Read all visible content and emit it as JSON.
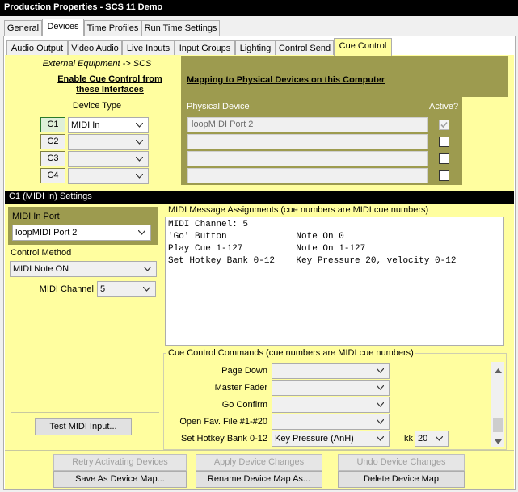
{
  "window": {
    "title": "Production Properties - SCS 11 Demo"
  },
  "top_tabs": [
    "General",
    "Devices",
    "Time Profiles",
    "Run Time Settings"
  ],
  "device_tabs": [
    "Audio Output",
    "Video Audio",
    "Live Inputs",
    "Input Groups",
    "Lighting",
    "Control Send",
    "Cue Control"
  ],
  "left_panel": {
    "external": "External Equipment -> SCS",
    "enable_line1": "Enable Cue Control from",
    "enable_line2": "these Interfaces",
    "device_type_header": "Device Type"
  },
  "right_panel": {
    "mapping_title": "Mapping to Physical Devices on this Computer",
    "physical_header": "Physical Device",
    "active_header": "Active?"
  },
  "rows": [
    {
      "label": "C1",
      "type": "MIDI In",
      "physical": "loopMIDI Port 2",
      "active": true
    },
    {
      "label": "C2",
      "type": "",
      "physical": "",
      "active": false
    },
    {
      "label": "C3",
      "type": "",
      "physical": "",
      "active": false
    },
    {
      "label": "C4",
      "type": "",
      "physical": "",
      "active": false
    }
  ],
  "settings_bar": "C1 (MIDI In) Settings",
  "midi_in_port": {
    "label": "MIDI In Port",
    "value": "loopMIDI Port 2"
  },
  "control_method": {
    "label": "Control Method",
    "value": "MIDI Note ON"
  },
  "midi_channel": {
    "label": "MIDI Channel",
    "value": "5"
  },
  "assignments": {
    "label": "MIDI Message Assignments (cue numbers are MIDI cue numbers)",
    "lines": [
      "MIDI Channel: 5",
      "'Go' Button             Note On 0",
      "Play Cue 1-127          Note On 1-127",
      "Set Hotkey Bank 0-12    Key Pressure 20, velocity 0-12"
    ]
  },
  "commands": {
    "label": "Cue Control Commands (cue numbers are MIDI cue numbers)",
    "items": [
      {
        "name": "Page Down",
        "value": ""
      },
      {
        "name": "Master Fader",
        "value": ""
      },
      {
        "name": "Go Confirm",
        "value": ""
      },
      {
        "name": "Open Fav. File #1-#20",
        "value": ""
      },
      {
        "name": "Set Hotkey Bank 0-12",
        "value": "Key Pressure (AnH)"
      }
    ],
    "kk_label": "kk",
    "kk_value": "20"
  },
  "test_button": "Test MIDI Input...",
  "buttons": {
    "retry": "Retry Activating Devices",
    "apply": "Apply Device Changes",
    "undo": "Undo Device Changes",
    "save_map": "Save As Device Map...",
    "rename_map": "Rename Device Map As...",
    "delete_map": "Delete Device Map"
  },
  "colors": {
    "panel_yellow": "#fffe9f",
    "band_olive": "#9d9b4f",
    "title_black": "#000000"
  }
}
